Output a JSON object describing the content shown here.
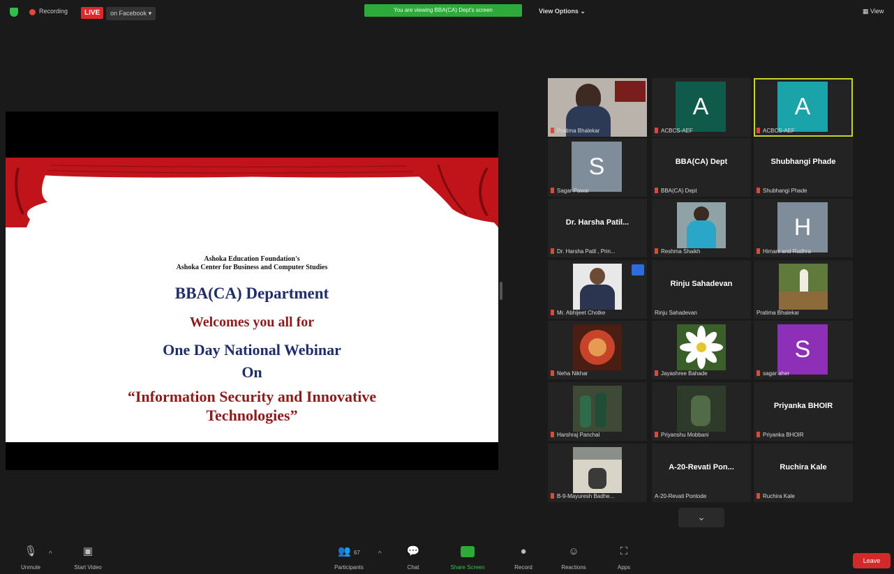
{
  "topbar": {
    "recording_label": "Recording",
    "live_label": "LIVE",
    "facebook_label": "on Facebook",
    "share_banner": "You are viewing BBA(CA) Dept's screen",
    "view_options": "View Options",
    "view_button": "View"
  },
  "slide": {
    "line1": "Ashoka Education Foundation's",
    "line2": "Ashoka Center for Business and Computer Studies",
    "line3": "BBA(CA) Department",
    "line4": "Welcomes you all for",
    "line5": "One Day National Webinar",
    "line6": "On",
    "line7": "“Information Security and Innovative",
    "line8": "Technologies”"
  },
  "participants": [
    {
      "label": "Pratima Bhalekar"
    },
    {
      "initial": "A",
      "label": "ACBCS-AEF",
      "color": "#0f5a4a"
    },
    {
      "initial": "A",
      "label": "ACBCS-AEF",
      "color": "#1aa3a8"
    },
    {
      "initial": "S",
      "label": "Sagar Pawar",
      "color": "#7f8c9a"
    },
    {
      "name": "BBA(CA) Dept",
      "label": "BBA(CA) Dept"
    },
    {
      "name": "Shubhangi Phade",
      "label": "Shubhangi Phade"
    },
    {
      "name": "Dr. Harsha Patil...",
      "label": "Dr. Harsha Patil , Prin..."
    },
    {
      "label": "Reshma Shaikh"
    },
    {
      "initial": "H",
      "label": "Himani and Rudhra",
      "color": "#7f8c9a"
    },
    {
      "label": "Mr. Abhijeet Chotke"
    },
    {
      "name": "Rinju Sahadevan",
      "label": "Rinju Sahadevan"
    },
    {
      "label": "Pratima Bhalekar"
    },
    {
      "label": "Neha Nikhar"
    },
    {
      "label": "Jayashree Bahade"
    },
    {
      "initial": "S",
      "label": "sagar aher",
      "color": "#8e2fb8"
    },
    {
      "label": "Harshraj Panchal"
    },
    {
      "label": "Priyanshu Mobbani"
    },
    {
      "name": "Priyanka BHOIR",
      "label": "Priyanka BHOIR"
    },
    {
      "label": "B-9-Mayuresh Badhe..."
    },
    {
      "name": "A-20-Revati Pon...",
      "label": "A-20-Revati Pontode"
    },
    {
      "name": "Ruchira Kale",
      "label": "Ruchira Kale"
    }
  ],
  "toolbar": {
    "unmute": "Unmute",
    "start_video": "Start Video",
    "participants": "Participants",
    "participants_count": "67",
    "chat": "Chat",
    "share_screen": "Share Screen",
    "record": "Record",
    "reactions": "Reactions",
    "apps": "Apps",
    "leave": "Leave"
  }
}
